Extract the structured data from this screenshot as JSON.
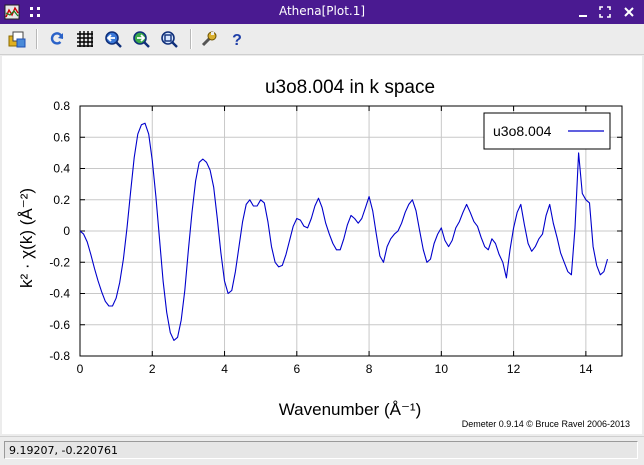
{
  "window": {
    "title": "Athena[Plot.1]"
  },
  "toolbar": {
    "buttons": [
      {
        "name": "open-icon",
        "color": "#d9a300"
      },
      {
        "name": "refresh-icon",
        "color": "#2a62c8"
      },
      {
        "name": "grid-icon",
        "color": "#000000"
      },
      {
        "name": "zoom-back-icon",
        "color": "#1f4fb3"
      },
      {
        "name": "zoom-forward-icon",
        "color": "#1b7a2a"
      },
      {
        "name": "zoom-reset-icon",
        "color": "#1f4fb3"
      },
      {
        "name": "wrench-icon",
        "color": "#c9a227"
      },
      {
        "name": "help-icon",
        "color": "#1f3fa8"
      }
    ]
  },
  "status": {
    "coords": "9.19207, -0.220761"
  },
  "credit": "Demeter 0.9.14 © Bruce Ravel 2006-2013",
  "chart_data": {
    "type": "line",
    "title": "u3o8.004 in k space",
    "xlabel": "Wavenumber   (Å⁻¹)",
    "ylabel": "k² · χ(k)   (Å⁻²)",
    "xlim": [
      0,
      15
    ],
    "ylim": [
      -0.8,
      0.8
    ],
    "xticks": [
      0,
      2,
      4,
      6,
      8,
      10,
      12,
      14
    ],
    "xtick_labels": [
      "0",
      "2",
      "4",
      "6",
      "8",
      "10",
      "12",
      "14"
    ],
    "yticks": [
      -0.8,
      -0.6,
      -0.4,
      -0.2,
      0,
      0.2,
      0.4,
      0.6,
      0.8
    ],
    "ytick_labels": [
      "-0.8",
      "-0.6",
      "-0.4",
      "-0.2",
      "0",
      "0.2",
      "0.4",
      "0.6",
      "0.8"
    ],
    "grid": true,
    "legend": "top-right",
    "series": [
      {
        "name": "u3o8.004",
        "color": "#0000cc",
        "x": [
          0,
          0.1,
          0.2,
          0.3,
          0.4,
          0.5,
          0.6,
          0.7,
          0.8,
          0.9,
          1.0,
          1.1,
          1.2,
          1.3,
          1.4,
          1.5,
          1.6,
          1.7,
          1.8,
          1.9,
          2.0,
          2.1,
          2.2,
          2.3,
          2.4,
          2.5,
          2.6,
          2.7,
          2.8,
          2.9,
          3.0,
          3.1,
          3.2,
          3.3,
          3.4,
          3.5,
          3.6,
          3.7,
          3.8,
          3.9,
          4.0,
          4.1,
          4.2,
          4.3,
          4.4,
          4.5,
          4.6,
          4.7,
          4.8,
          4.9,
          5.0,
          5.1,
          5.2,
          5.3,
          5.4,
          5.5,
          5.6,
          5.7,
          5.8,
          5.9,
          6.0,
          6.1,
          6.2,
          6.3,
          6.4,
          6.5,
          6.6,
          6.7,
          6.8,
          6.9,
          7.0,
          7.1,
          7.2,
          7.3,
          7.4,
          7.5,
          7.6,
          7.7,
          7.8,
          7.9,
          8.0,
          8.1,
          8.2,
          8.3,
          8.4,
          8.5,
          8.6,
          8.7,
          8.8,
          8.9,
          9.0,
          9.1,
          9.2,
          9.3,
          9.4,
          9.5,
          9.6,
          9.7,
          9.8,
          9.9,
          10.0,
          10.1,
          10.2,
          10.3,
          10.4,
          10.5,
          10.6,
          10.7,
          10.8,
          10.9,
          11.0,
          11.1,
          11.2,
          11.3,
          11.4,
          11.5,
          11.6,
          11.7,
          11.8,
          11.9,
          12.0,
          12.1,
          12.2,
          12.3,
          12.4,
          12.5,
          12.6,
          12.7,
          12.8,
          12.9,
          13.0,
          13.1,
          13.2,
          13.3,
          13.4,
          13.5,
          13.6,
          13.7,
          13.8,
          13.9,
          14.0,
          14.1,
          14.2,
          14.3,
          14.4,
          14.5,
          14.6
        ],
        "y": [
          0,
          -0.02,
          -0.07,
          -0.15,
          -0.24,
          -0.32,
          -0.39,
          -0.45,
          -0.48,
          -0.48,
          -0.43,
          -0.33,
          -0.18,
          0.02,
          0.25,
          0.47,
          0.62,
          0.68,
          0.69,
          0.62,
          0.45,
          0.22,
          -0.05,
          -0.32,
          -0.52,
          -0.65,
          -0.7,
          -0.68,
          -0.57,
          -0.38,
          -0.12,
          0.12,
          0.32,
          0.44,
          0.46,
          0.44,
          0.39,
          0.28,
          0.08,
          -0.14,
          -0.32,
          -0.4,
          -0.38,
          -0.26,
          -0.1,
          0.06,
          0.17,
          0.2,
          0.16,
          0.16,
          0.2,
          0.18,
          0.06,
          -0.1,
          -0.2,
          -0.23,
          -0.22,
          -0.15,
          -0.06,
          0.03,
          0.08,
          0.07,
          0.03,
          0.02,
          0.08,
          0.16,
          0.21,
          0.15,
          0.05,
          -0.02,
          -0.08,
          -0.12,
          -0.12,
          -0.05,
          0.04,
          0.1,
          0.08,
          0.05,
          0.08,
          0.15,
          0.22,
          0.13,
          -0.02,
          -0.16,
          -0.2,
          -0.1,
          -0.05,
          -0.02,
          0,
          0.05,
          0.12,
          0.17,
          0.2,
          0.13,
          0,
          -0.12,
          -0.2,
          -0.18,
          -0.08,
          -0.02,
          0.02,
          -0.06,
          -0.1,
          -0.06,
          0.02,
          0.06,
          0.12,
          0.17,
          0.12,
          0.06,
          0.03,
          -0.04,
          -0.1,
          -0.12,
          -0.05,
          -0.08,
          -0.15,
          -0.2,
          -0.3,
          -0.12,
          0.02,
          0.12,
          0.17,
          0.04,
          -0.08,
          -0.13,
          -0.1,
          -0.05,
          -0.02,
          0.1,
          0.17,
          0.05,
          -0.04,
          -0.14,
          -0.2,
          -0.26,
          -0.28,
          0.02,
          0.5,
          0.24,
          0.2,
          0.18,
          -0.1,
          -0.22,
          -0.28,
          -0.26,
          -0.18
        ]
      }
    ]
  }
}
